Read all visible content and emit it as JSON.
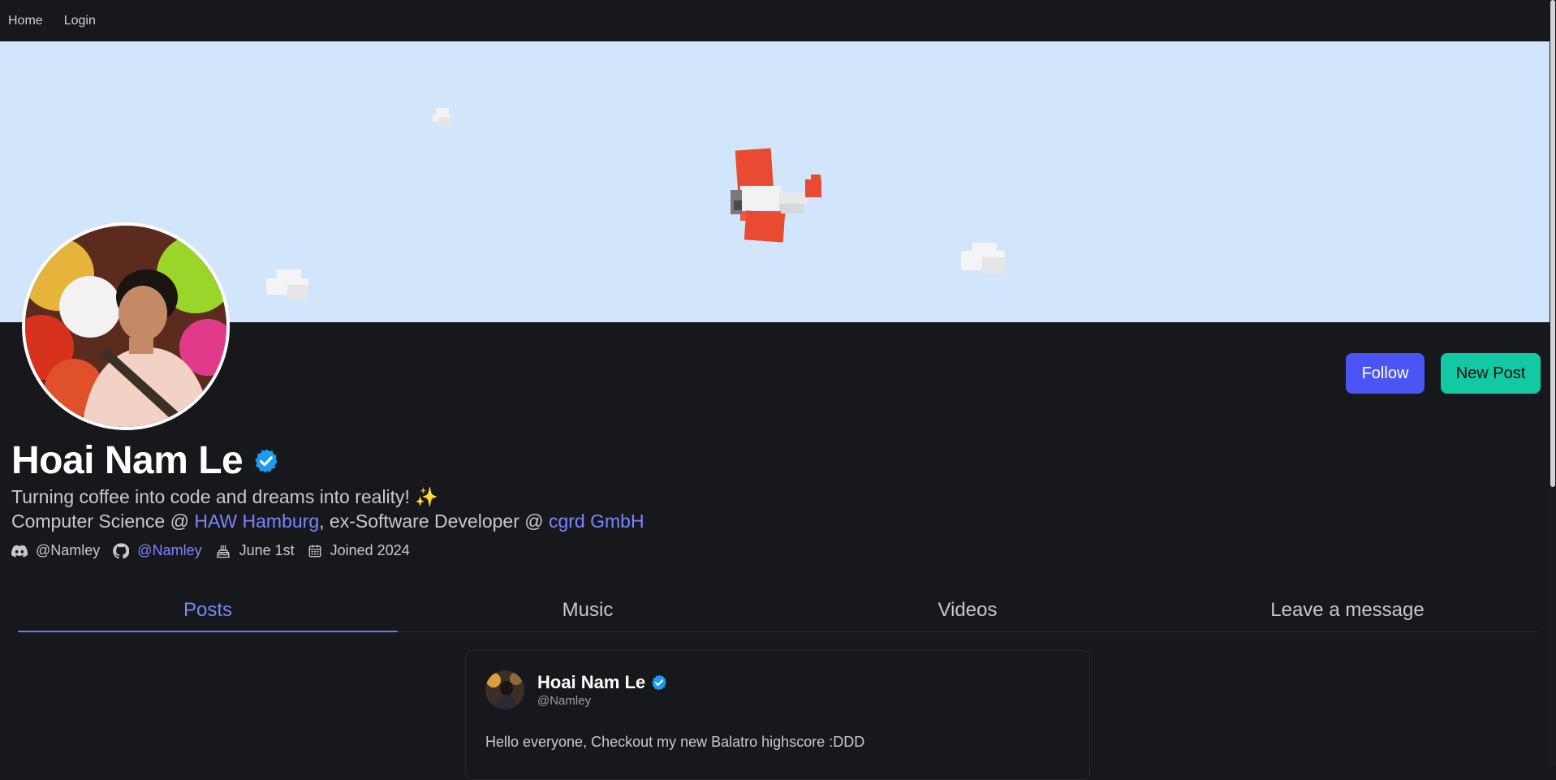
{
  "nav": {
    "home": "Home",
    "login": "Login"
  },
  "profile": {
    "name": "Hoai Nam Le",
    "bio_line1": "Turning coffee into code and dreams into reality!",
    "bio_sparkle": "✨",
    "bio_line2_prefix": "Computer Science @ ",
    "bio_line2_link1": "HAW Hamburg",
    "bio_line2_middle": ", ex-Software Developer @ ",
    "bio_line2_link2": "cgrd GmbH",
    "discord": "@Namley",
    "github": "@Namley",
    "birthday": "June 1st",
    "joined": "Joined 2024"
  },
  "actions": {
    "follow": "Follow",
    "new_post": "New Post"
  },
  "tabs": [
    {
      "label": "Posts",
      "active": true
    },
    {
      "label": "Music"
    },
    {
      "label": "Videos"
    },
    {
      "label": "Leave a message"
    }
  ],
  "post": {
    "author": "Hoai Nam Le",
    "handle": "@Namley",
    "text": "Hello everyone, Checkout my new Balatro highscore :DDD"
  },
  "colors": {
    "accent": "#4b55f5",
    "secondary": "#12c9a3",
    "link": "#7b86ff",
    "background": "#17181c",
    "banner_sky": "#d2e6fb"
  },
  "icons": [
    "discord-icon",
    "github-icon",
    "cake-icon",
    "calendar-icon",
    "verified-badge-icon"
  ]
}
